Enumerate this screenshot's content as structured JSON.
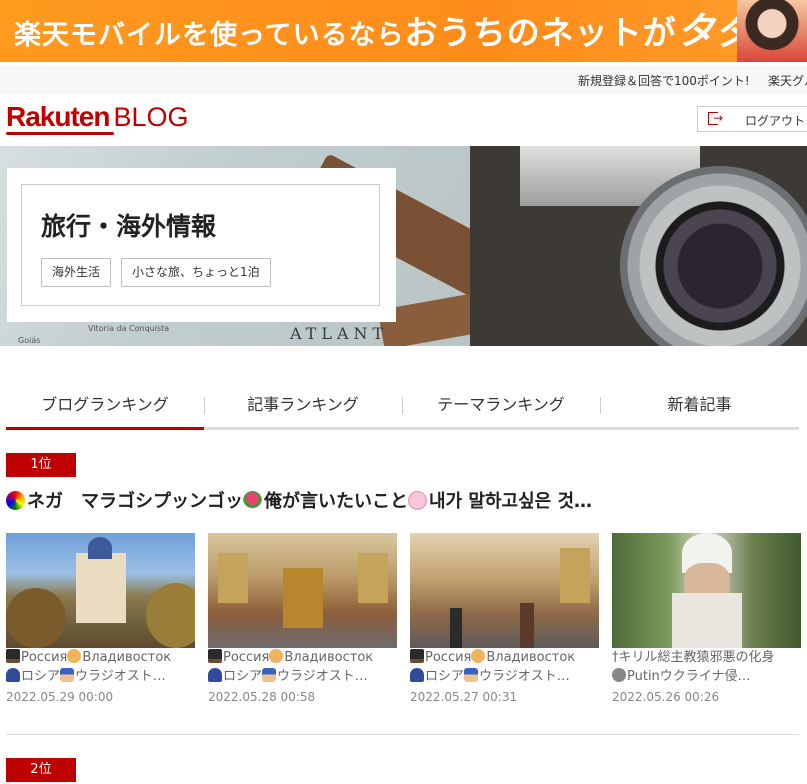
{
  "ad": {
    "text_main": "楽天モバイルを使っているなら",
    "text_big": "おうちのネットが",
    "text_free": "タダ!!"
  },
  "utilbar": {
    "promo": "新規登録＆回答で100ポイント!",
    "group": "楽天グル"
  },
  "header": {
    "logo_rakuten": "Rakuten",
    "logo_blog": "BLOG",
    "logout_label": "ログアウト"
  },
  "hero": {
    "title": "旅行・海外情報",
    "tags": [
      "海外生活",
      "小さな旅、ちょっと1泊"
    ],
    "map_text_atlantic": "ATLANT",
    "map_text_city": "Vitoria da Conquista",
    "map_text_goias": "Goiás"
  },
  "tabs": [
    "ブログランキング",
    "記事ランキング",
    "テーマランキング",
    "新着記事"
  ],
  "active_tab": "ブログランキング",
  "ranking": [
    {
      "rank": "1位",
      "blog_title": "ネガ　マラゴシプッンゴッ 俺が言いたいこと 내가 말하고싶은 것…",
      "title_part1": "ネガ　マラゴシプッンゴッ",
      "title_part2": "俺が言いたいこと",
      "title_part3": "내가 말하고싶은 것…",
      "articles": [
        {
          "line1": "Россия Владивосток",
          "line1_a": "Россия",
          "line1_b": "Владивосток",
          "line2_a": "ロシア",
          "line2_b": "ウラジオスト…",
          "date": "2022.05.29 00:00"
        },
        {
          "line1": "Россия Владивосток",
          "line1_a": "Россия",
          "line1_b": "Владивосток",
          "line2_a": "ロシア",
          "line2_b": "ウラジオスト…",
          "date": "2022.05.28 00:58"
        },
        {
          "line1": "Россия Владивосток",
          "line1_a": "Россия",
          "line1_b": "Владивосток",
          "line2_a": "ロシア",
          "line2_b": "ウラジオスト…",
          "date": "2022.05.27 00:31"
        },
        {
          "line1": "†キリル総主教猿邪悪の化身",
          "line2_b": "Putinウクライナ侵…",
          "date": "2022.05.26 00:26"
        }
      ]
    },
    {
      "rank": "2位"
    }
  ],
  "colors": {
    "brand_red": "#bf0000",
    "ad_orange": "#ff9a1f",
    "tab_active": "#bf0000"
  }
}
